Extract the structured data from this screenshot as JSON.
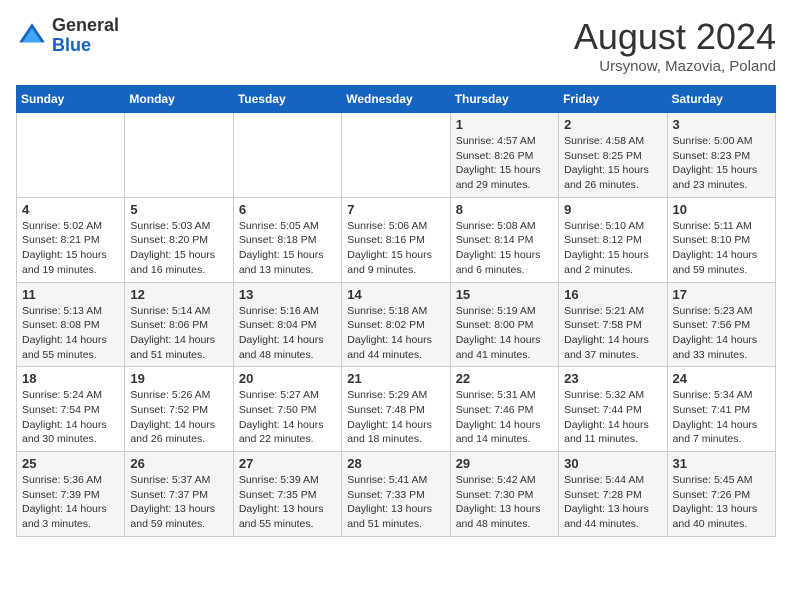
{
  "header": {
    "logo_line1": "General",
    "logo_line2": "Blue",
    "month": "August 2024",
    "location": "Ursynow, Mazovia, Poland"
  },
  "weekdays": [
    "Sunday",
    "Monday",
    "Tuesday",
    "Wednesday",
    "Thursday",
    "Friday",
    "Saturday"
  ],
  "weeks": [
    [
      {
        "day": "",
        "info": ""
      },
      {
        "day": "",
        "info": ""
      },
      {
        "day": "",
        "info": ""
      },
      {
        "day": "",
        "info": ""
      },
      {
        "day": "1",
        "info": "Sunrise: 4:57 AM\nSunset: 8:26 PM\nDaylight: 15 hours\nand 29 minutes."
      },
      {
        "day": "2",
        "info": "Sunrise: 4:58 AM\nSunset: 8:25 PM\nDaylight: 15 hours\nand 26 minutes."
      },
      {
        "day": "3",
        "info": "Sunrise: 5:00 AM\nSunset: 8:23 PM\nDaylight: 15 hours\nand 23 minutes."
      }
    ],
    [
      {
        "day": "4",
        "info": "Sunrise: 5:02 AM\nSunset: 8:21 PM\nDaylight: 15 hours\nand 19 minutes."
      },
      {
        "day": "5",
        "info": "Sunrise: 5:03 AM\nSunset: 8:20 PM\nDaylight: 15 hours\nand 16 minutes."
      },
      {
        "day": "6",
        "info": "Sunrise: 5:05 AM\nSunset: 8:18 PM\nDaylight: 15 hours\nand 13 minutes."
      },
      {
        "day": "7",
        "info": "Sunrise: 5:06 AM\nSunset: 8:16 PM\nDaylight: 15 hours\nand 9 minutes."
      },
      {
        "day": "8",
        "info": "Sunrise: 5:08 AM\nSunset: 8:14 PM\nDaylight: 15 hours\nand 6 minutes."
      },
      {
        "day": "9",
        "info": "Sunrise: 5:10 AM\nSunset: 8:12 PM\nDaylight: 15 hours\nand 2 minutes."
      },
      {
        "day": "10",
        "info": "Sunrise: 5:11 AM\nSunset: 8:10 PM\nDaylight: 14 hours\nand 59 minutes."
      }
    ],
    [
      {
        "day": "11",
        "info": "Sunrise: 5:13 AM\nSunset: 8:08 PM\nDaylight: 14 hours\nand 55 minutes."
      },
      {
        "day": "12",
        "info": "Sunrise: 5:14 AM\nSunset: 8:06 PM\nDaylight: 14 hours\nand 51 minutes."
      },
      {
        "day": "13",
        "info": "Sunrise: 5:16 AM\nSunset: 8:04 PM\nDaylight: 14 hours\nand 48 minutes."
      },
      {
        "day": "14",
        "info": "Sunrise: 5:18 AM\nSunset: 8:02 PM\nDaylight: 14 hours\nand 44 minutes."
      },
      {
        "day": "15",
        "info": "Sunrise: 5:19 AM\nSunset: 8:00 PM\nDaylight: 14 hours\nand 41 minutes."
      },
      {
        "day": "16",
        "info": "Sunrise: 5:21 AM\nSunset: 7:58 PM\nDaylight: 14 hours\nand 37 minutes."
      },
      {
        "day": "17",
        "info": "Sunrise: 5:23 AM\nSunset: 7:56 PM\nDaylight: 14 hours\nand 33 minutes."
      }
    ],
    [
      {
        "day": "18",
        "info": "Sunrise: 5:24 AM\nSunset: 7:54 PM\nDaylight: 14 hours\nand 30 minutes."
      },
      {
        "day": "19",
        "info": "Sunrise: 5:26 AM\nSunset: 7:52 PM\nDaylight: 14 hours\nand 26 minutes."
      },
      {
        "day": "20",
        "info": "Sunrise: 5:27 AM\nSunset: 7:50 PM\nDaylight: 14 hours\nand 22 minutes."
      },
      {
        "day": "21",
        "info": "Sunrise: 5:29 AM\nSunset: 7:48 PM\nDaylight: 14 hours\nand 18 minutes."
      },
      {
        "day": "22",
        "info": "Sunrise: 5:31 AM\nSunset: 7:46 PM\nDaylight: 14 hours\nand 14 minutes."
      },
      {
        "day": "23",
        "info": "Sunrise: 5:32 AM\nSunset: 7:44 PM\nDaylight: 14 hours\nand 11 minutes."
      },
      {
        "day": "24",
        "info": "Sunrise: 5:34 AM\nSunset: 7:41 PM\nDaylight: 14 hours\nand 7 minutes."
      }
    ],
    [
      {
        "day": "25",
        "info": "Sunrise: 5:36 AM\nSunset: 7:39 PM\nDaylight: 14 hours\nand 3 minutes."
      },
      {
        "day": "26",
        "info": "Sunrise: 5:37 AM\nSunset: 7:37 PM\nDaylight: 13 hours\nand 59 minutes."
      },
      {
        "day": "27",
        "info": "Sunrise: 5:39 AM\nSunset: 7:35 PM\nDaylight: 13 hours\nand 55 minutes."
      },
      {
        "day": "28",
        "info": "Sunrise: 5:41 AM\nSunset: 7:33 PM\nDaylight: 13 hours\nand 51 minutes."
      },
      {
        "day": "29",
        "info": "Sunrise: 5:42 AM\nSunset: 7:30 PM\nDaylight: 13 hours\nand 48 minutes."
      },
      {
        "day": "30",
        "info": "Sunrise: 5:44 AM\nSunset: 7:28 PM\nDaylight: 13 hours\nand 44 minutes."
      },
      {
        "day": "31",
        "info": "Sunrise: 5:45 AM\nSunset: 7:26 PM\nDaylight: 13 hours\nand 40 minutes."
      }
    ]
  ]
}
